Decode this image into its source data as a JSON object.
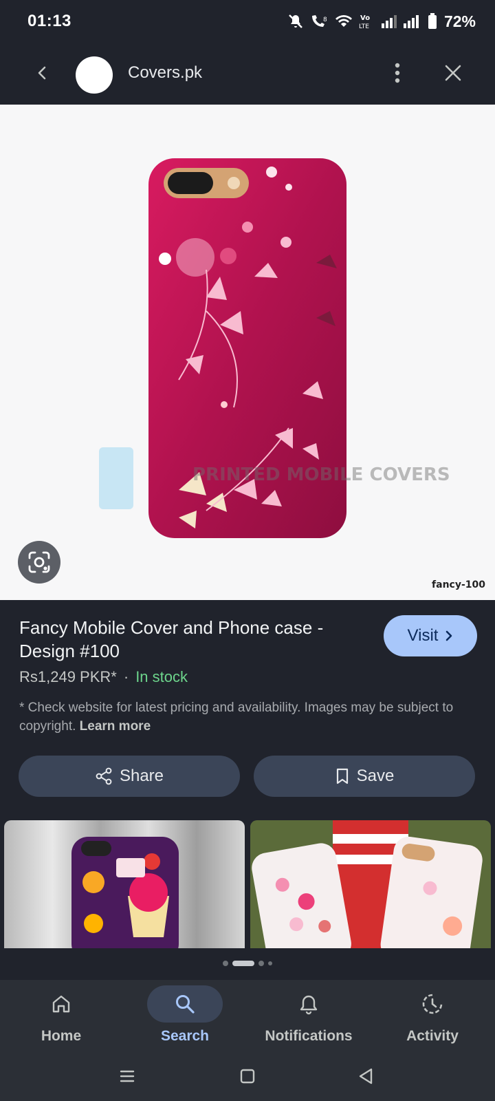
{
  "status_bar": {
    "time": "01:13",
    "battery_percent": "72%"
  },
  "top_bar": {
    "site_name": "Covers.pk"
  },
  "image": {
    "caption": "fancy-100",
    "watermark": "PRINTED MOBILE COVERS",
    "case_color": "#c2185b"
  },
  "product": {
    "title": "Fancy Mobile Cover and Phone case - Design #100",
    "price": "Rs1,249 PKR*",
    "separator": "·",
    "stock_status": "In stock",
    "disclaimer": "* Check website for latest pricing and availability. Images may be subject to copyright.",
    "learn_more": "Learn more",
    "visit_label": "Visit"
  },
  "actions": {
    "share_label": "Share",
    "save_label": "Save"
  },
  "pager": {
    "pages": 4,
    "active_index": 1
  },
  "bottom_nav": {
    "items": [
      {
        "label": "Home",
        "icon": "home-icon",
        "active": false
      },
      {
        "label": "Search",
        "icon": "search-icon",
        "active": true
      },
      {
        "label": "Notifications",
        "icon": "bell-icon",
        "active": false
      },
      {
        "label": "Activity",
        "icon": "activity-icon",
        "active": false
      }
    ]
  },
  "colors": {
    "background": "#20232c",
    "accent": "#a8c7fa",
    "in_stock": "#6dd58c",
    "button": "#3b4558"
  }
}
